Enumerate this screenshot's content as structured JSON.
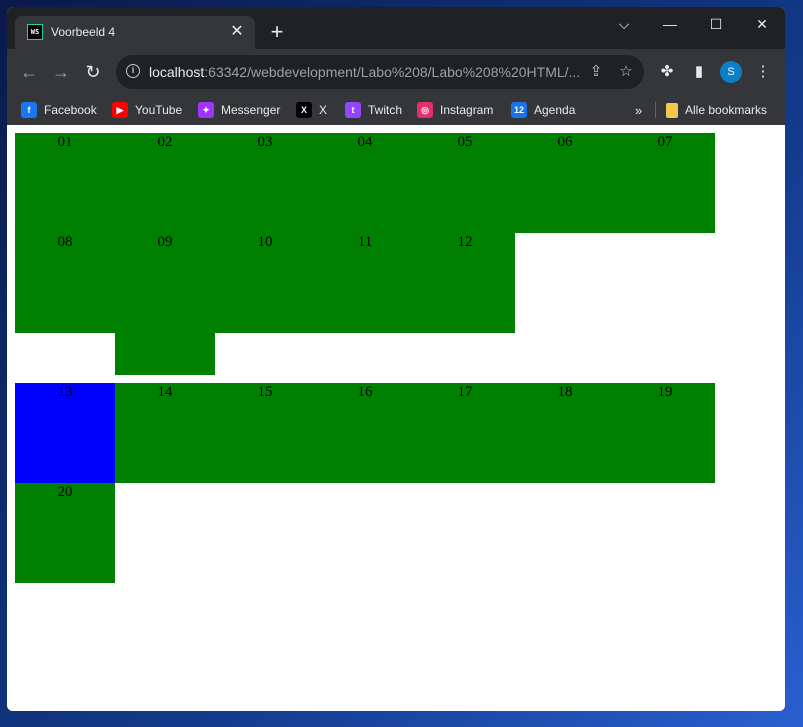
{
  "browser": {
    "tab": {
      "favicon_text": "WS",
      "title": "Voorbeeld 4"
    },
    "omnibox": {
      "host": "localhost",
      "rest": ":63342/webdevelopment/Labo%208/Labo%208%20HTML/..."
    },
    "profile_initial": "S",
    "bookmarks": [
      {
        "label": "Facebook",
        "icon": "facebook-icon",
        "color": "#1877f2",
        "glyph": "f"
      },
      {
        "label": "YouTube",
        "icon": "youtube-icon",
        "color": "#ff0000",
        "glyph": "▶"
      },
      {
        "label": "Messenger",
        "icon": "messenger-icon",
        "color": "#a033ff",
        "glyph": "✦"
      },
      {
        "label": "X",
        "icon": "x-icon",
        "color": "#000000",
        "glyph": "X"
      },
      {
        "label": "Twitch",
        "icon": "twitch-icon",
        "color": "#9146ff",
        "glyph": "t"
      },
      {
        "label": "Instagram",
        "icon": "instagram-icon",
        "color": "#e1306c",
        "glyph": "◎"
      },
      {
        "label": "Agenda",
        "icon": "calendar-icon",
        "color": "#1a73e8",
        "glyph": "12"
      }
    ],
    "all_bookmarks_label": "Alle bookmarks",
    "more_bookmarks": "»"
  },
  "page": {
    "colors": {
      "cell": "#008000",
      "highlight": "#0000ff",
      "background": "#ffffff"
    },
    "cells": [
      "01",
      "02",
      "03",
      "04",
      "05",
      "06",
      "07",
      "08",
      "09",
      "10",
      "11",
      "12",
      "13",
      "14",
      "15",
      "16",
      "17",
      "18",
      "19",
      "20"
    ],
    "highlighted_cell": "13"
  }
}
